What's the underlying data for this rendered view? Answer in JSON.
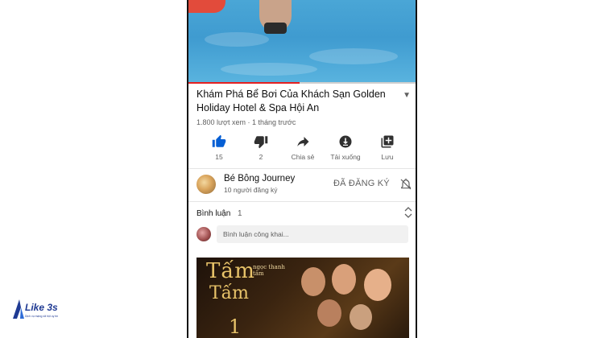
{
  "video": {
    "title": "Khám Phá Bể Bơi Của Khách Sạn Golden Holiday Hotel & Spa Hội An",
    "meta": "1.800 lượt xem · 1 tháng trước",
    "progress_fraction": 0.49
  },
  "actions": [
    {
      "icon": "thumbs-up-icon",
      "label": "15"
    },
    {
      "icon": "thumbs-down-icon",
      "label": "2"
    },
    {
      "icon": "share-icon",
      "label": "Chia sẻ"
    },
    {
      "icon": "download-icon",
      "label": "Tải xuống"
    },
    {
      "icon": "save-playlist-icon",
      "label": "Lưu"
    }
  ],
  "channel": {
    "name": "Bé Bông Journey",
    "subscribers": "10 người đăng ký",
    "subscribed_label": "ĐÃ ĐĂNG KÝ"
  },
  "comments": {
    "heading": "Bình luận",
    "count": "1",
    "placeholder": "Bình luận công khai..."
  },
  "poster": {
    "title": "Tấm",
    "subtitle": "Tấm",
    "small": "ngọc thanh tâm",
    "number": "1"
  },
  "logo": {
    "text": "Like 3s",
    "sub": "Dịch vụ mạng xã hội uy tín"
  },
  "colors": {
    "accent_red": "#e52020",
    "like_blue": "#065fd4",
    "text_primary": "#0f0f0f",
    "text_secondary": "#606060"
  }
}
